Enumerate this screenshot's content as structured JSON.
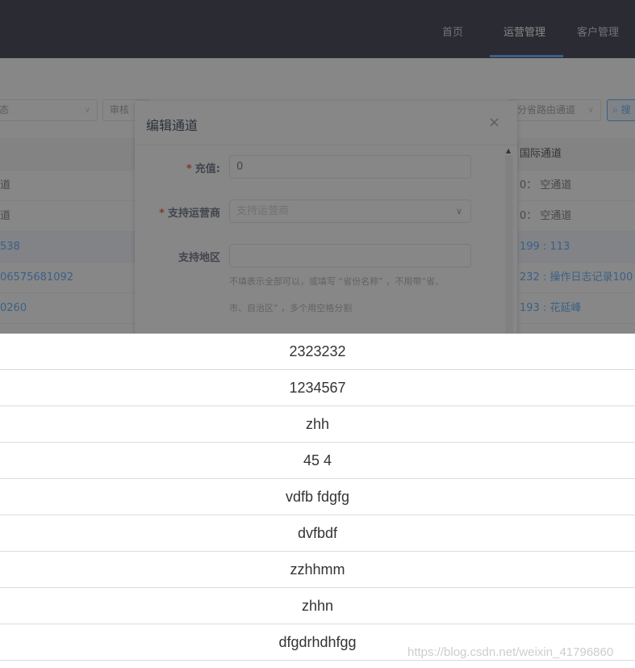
{
  "nav": {
    "items": [
      "首页",
      "运营管理",
      "客户管理"
    ],
    "active_index": 1
  },
  "filters": {
    "status_partial": "态",
    "audit_partial": "审核",
    "route_partial": "分省路由通道",
    "search_partial": "搜"
  },
  "table": {
    "header_right": "国际通道",
    "rows": [
      {
        "left": "道",
        "right": "0： 空通道",
        "highlight": false
      },
      {
        "left": "道",
        "right": "0： 空通道",
        "highlight": false
      },
      {
        "left": "538",
        "right": "199 : 113",
        "highlight": true
      },
      {
        "left": "06575681092",
        "right": "232 : 操作日志记录100",
        "highlight": false
      },
      {
        "left": "0260",
        "right": "193 : 花延峰",
        "highlight": false
      }
    ]
  },
  "modal": {
    "title": "编辑通道",
    "close_glyph": "×",
    "fields": {
      "recharge": {
        "label": "充值:",
        "required_mark": "*",
        "value": "0"
      },
      "carrier": {
        "label": "支持运营商",
        "required_mark": "*",
        "placeholder": "支持运营商"
      },
      "region": {
        "label": "支持地区",
        "value": "",
        "hint_line1": "不填表示全部可以，或填写 “省份名称” ，不用带“省、",
        "hint_line2": "市、自治区” ，多个用空格分割"
      }
    }
  },
  "list_items": [
    "2323232",
    "1234567",
    "zhh",
    "45 4",
    "vdfb fdgfg",
    "dvfbdf",
    "zzhhmm",
    "zhhn",
    "dfgdrhdhfgg"
  ],
  "watermark": "https://blog.csdn.net/weixin_41796860",
  "colors": {
    "navbar": "#1b1c2e",
    "accent": "#409eff",
    "required": "#ed4014",
    "overlay": "rgba(55,55,55,0.6)"
  }
}
